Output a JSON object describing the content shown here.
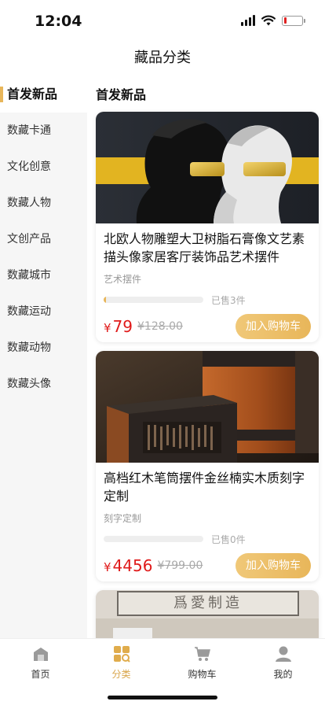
{
  "status": {
    "time": "12:04"
  },
  "nav": {
    "title": "藏品分类"
  },
  "sidebar": {
    "items": [
      {
        "label": "首发新品"
      },
      {
        "label": "数藏卡通"
      },
      {
        "label": "文化创意"
      },
      {
        "label": "数藏人物"
      },
      {
        "label": "文创产品"
      },
      {
        "label": "数藏城市"
      },
      {
        "label": "数藏运动"
      },
      {
        "label": "数藏动物"
      },
      {
        "label": "数藏头像"
      }
    ],
    "active_index": 0
  },
  "content": {
    "section_title": "首发新品",
    "products": [
      {
        "title": "北欧人物雕塑大卫树脂石膏像文艺素描头像家居客厅装饰品艺术摆件",
        "subtitle": "艺术摆件",
        "sold": "已售3件",
        "progress": 0.02,
        "currency": "¥",
        "price": "79",
        "original_price": "¥128.00",
        "button": "加入购物车"
      },
      {
        "title": "高档红木笔筒摆件金丝楠实木质刻字定制",
        "subtitle": "刻字定制",
        "sold": "已售0件",
        "progress": 0,
        "currency": "¥",
        "price": "4456",
        "original_price": "¥799.00",
        "button": "加入购物车"
      },
      {
        "image_text": "爲愛制造"
      }
    ]
  },
  "tabbar": {
    "tabs": [
      {
        "label": "首页",
        "icon": "home-icon"
      },
      {
        "label": "分类",
        "icon": "category-icon"
      },
      {
        "label": "购物车",
        "icon": "cart-icon"
      },
      {
        "label": "我的",
        "icon": "user-icon"
      }
    ],
    "active_index": 1
  },
  "colors": {
    "accent": "#e8b65a",
    "price": "#e01a1a",
    "tab_active": "#d9a54a"
  }
}
